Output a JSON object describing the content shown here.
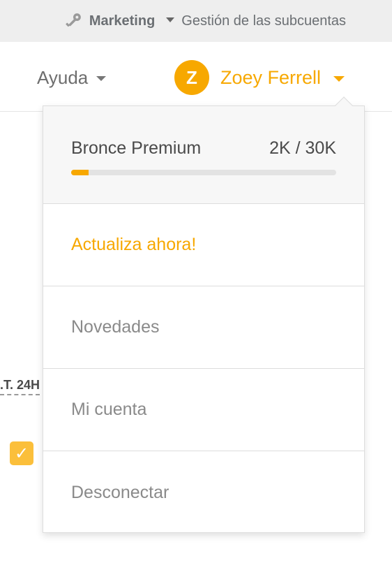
{
  "topbar": {
    "account_name": "Marketing",
    "subaccounts_label": "Gestión de las subcuentas"
  },
  "header": {
    "help_label": "Ayuda",
    "user": {
      "initial": "Z",
      "name": "Zoey Ferrell"
    }
  },
  "dropdown": {
    "plan": {
      "name": "Bronce Premium",
      "usage": "2K / 30K",
      "progress_fraction": 0.067
    },
    "items": [
      {
        "label": "Actualiza ahora!",
        "highlight": true
      },
      {
        "label": "Novedades",
        "highlight": false
      },
      {
        "label": "Mi cuenta",
        "highlight": false
      },
      {
        "label": "Desconectar",
        "highlight": false
      }
    ]
  },
  "background": {
    "partial_label": ".T. 24H",
    "checkbox_checked": true
  },
  "colors": {
    "accent": "#f7a800",
    "topbar_bg": "#eeeeee",
    "text_muted": "#8a8a8a"
  },
  "icons": {
    "topbar_account": "key-icon",
    "checkbox": "check-icon"
  }
}
